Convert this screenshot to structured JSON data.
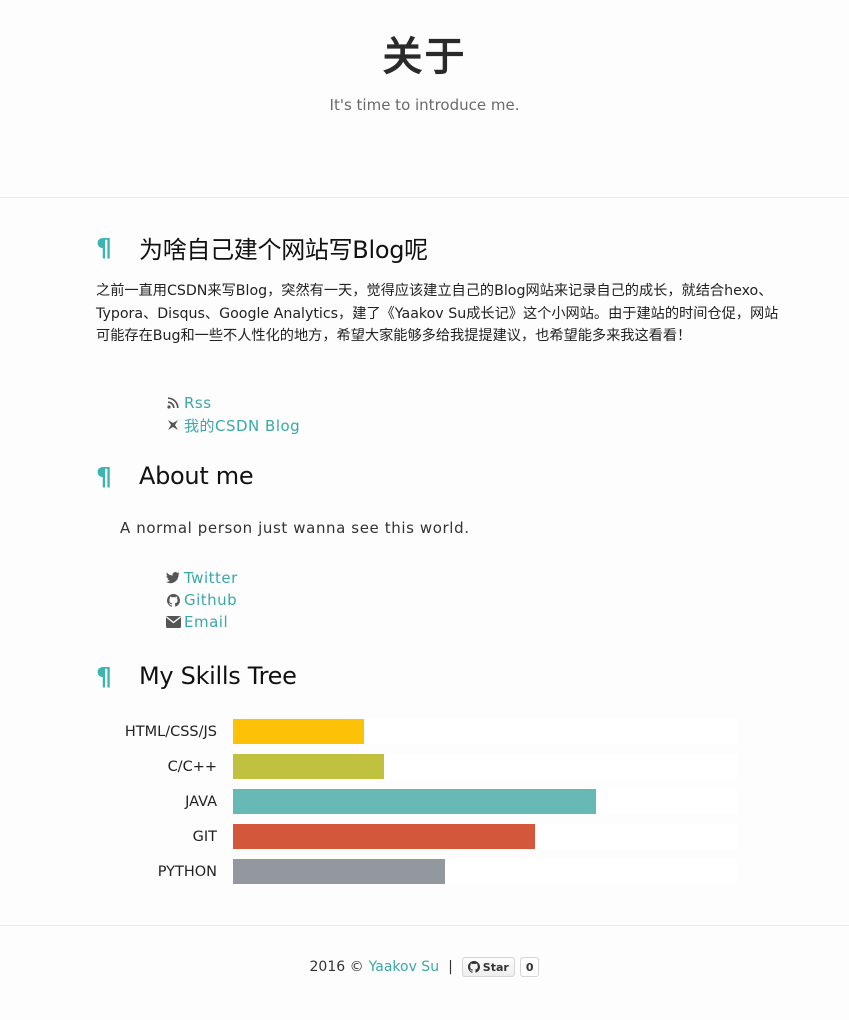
{
  "hero": {
    "title": "关于",
    "subtitle": "It's time to introduce me."
  },
  "sections": [
    {
      "title": "为啥自己建个网站写Blog呢",
      "paragraph": "之前一直用CSDN来写Blog，突然有一天，觉得应该建立自己的Blog网站来记录自己的成长，就结合hexo、Typora、Disqus、Google Analytics，建了《Yaakov Su成长记》这个小网站。由于建站的时间仓促，网站可能存在Bug和一些不人性化的地方，希望大家能够多给我提提建议，也希望能多来我这看看！",
      "links": [
        {
          "label": "Rss",
          "icon": "rss-icon"
        },
        {
          "label": "我的CSDN Blog",
          "icon": "csdn-icon"
        }
      ]
    },
    {
      "title": "About me",
      "text": "A normal person just wanna see this world.",
      "links": [
        {
          "label": "Twitter",
          "icon": "twitter-icon"
        },
        {
          "label": "Github",
          "icon": "github-icon"
        },
        {
          "label": "Email",
          "icon": "envelope-icon"
        }
      ]
    },
    {
      "title": "My Skills Tree"
    }
  ],
  "skills": [
    {
      "name": "HTML/CSS/JS",
      "level": 0.26,
      "color": "#fdc207"
    },
    {
      "name": "C/C++",
      "level": 0.3,
      "color": "#c0c23f"
    },
    {
      "name": "JAVA",
      "level": 0.72,
      "color": "#66b9b5"
    },
    {
      "name": "GIT",
      "level": 0.6,
      "color": "#d2573b"
    },
    {
      "name": "PYTHON",
      "level": 0.42,
      "color": "#93989f"
    }
  ],
  "footer": {
    "year": "2016 ©",
    "author": "Yaakov Su",
    "separator": "|",
    "star_label": "Star",
    "star_count": "0"
  },
  "colors": {
    "accent": "#3aa8a9",
    "pilcrow": "#3cb5b0"
  }
}
